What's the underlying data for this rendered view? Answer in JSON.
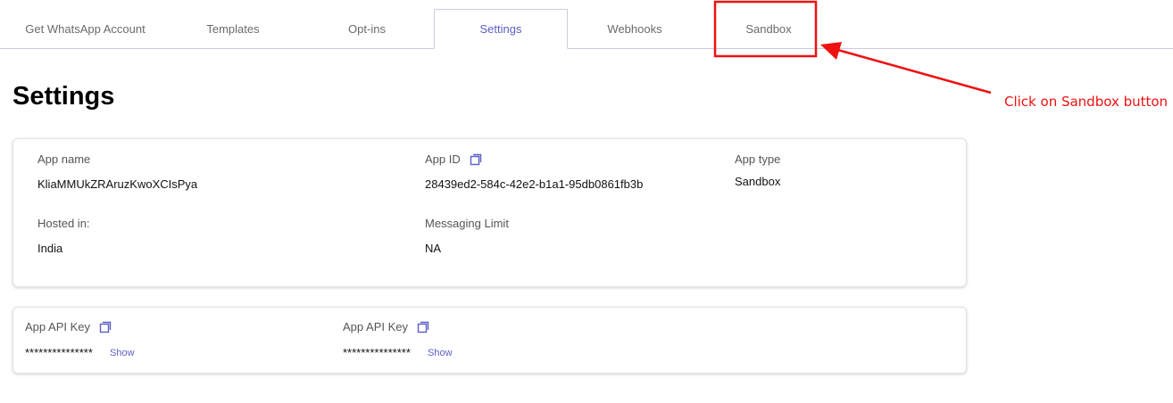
{
  "tabs": [
    {
      "label": "Get WhatsApp Account"
    },
    {
      "label": "Templates"
    },
    {
      "label": "Opt-ins"
    },
    {
      "label": "Settings",
      "active": true
    },
    {
      "label": "Webhooks"
    },
    {
      "label": "Sandbox"
    }
  ],
  "page": {
    "title": "Settings"
  },
  "app_info": {
    "app_name_label": "App name",
    "app_name_value": "KliaMMUkZRAruzKwoXCIsPya",
    "app_id_label": "App ID",
    "app_id_value": "28439ed2-584c-42e2-b1a1-95db0861fb3b",
    "app_type_label": "App type",
    "app_type_value": "Sandbox",
    "hosted_label": "Hosted in:",
    "hosted_value": "India",
    "limit_label": "Messaging Limit",
    "limit_value": "NA"
  },
  "api_keys": [
    {
      "label": "App API Key",
      "value": "***************",
      "show_label": "Show"
    },
    {
      "label": "App API Key",
      "value": "***************",
      "show_label": "Show"
    }
  ],
  "annotation": {
    "text": "Click on Sandbox button",
    "color": "#ee1111"
  },
  "colors": {
    "accent": "#5b5fc7",
    "annotation": "#ee1111"
  },
  "icons": {
    "copy": "copy-icon"
  }
}
